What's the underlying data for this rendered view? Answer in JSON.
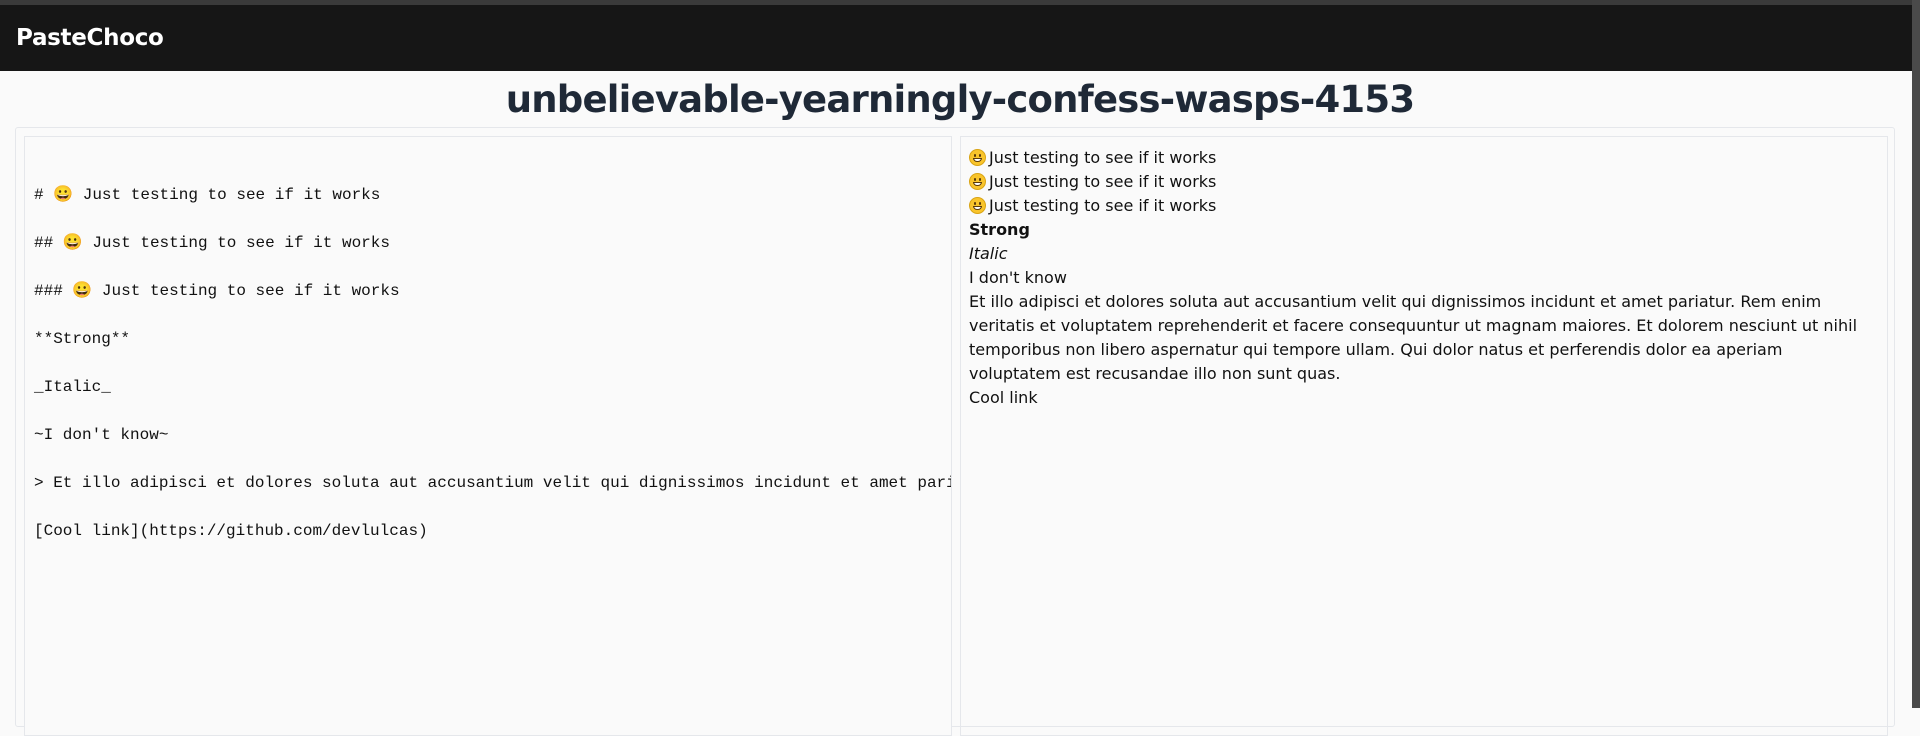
{
  "app": {
    "brand": "PasteChoco"
  },
  "paste": {
    "title": "unbelievable-yearningly-confess-wasps-4153"
  },
  "editor": {
    "lines": [
      "",
      "# 😀 Just testing to see if it works",
      "",
      "## 😀 Just testing to see if it works",
      "",
      "### 😀 Just testing to see if it works",
      "",
      "**Strong**",
      "",
      "_Italic_",
      "",
      "~I don't know~",
      "",
      "> Et illo adipisci et dolores soluta aut accusantium velit qui dignissimos incidunt et amet pari",
      "",
      "[Cool link](https://github.com/devlulcas)"
    ]
  },
  "preview": {
    "h1": "Just testing to see if it works",
    "h2": "Just testing to see if it works",
    "h3": "Just testing to see if it works",
    "strong": "Strong",
    "italic": "Italic",
    "strike": "I don't know",
    "blockquote": "Et illo adipisci et dolores soluta aut accusantium velit qui dignissimos incidunt et amet pariatur. Rem enim veritatis et voluptatem reprehenderit et facere consequuntur ut magnam maiores. Et dolorem nesciunt ut nihil temporibus non libero aspernatur qui tempore ullam. Qui dolor natus et perferendis dolor ea aperiam voluptatem est recusandae illo non sunt quas.",
    "link": "Cool link",
    "emoji_icon": "grinning-face-emoji"
  }
}
